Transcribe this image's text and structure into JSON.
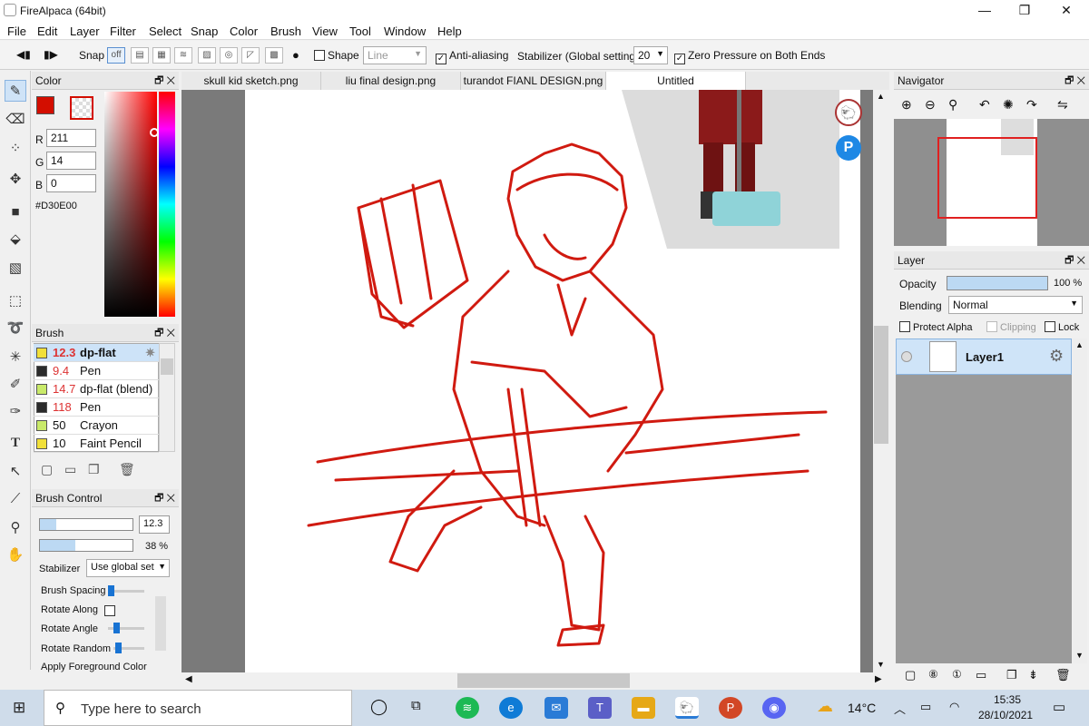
{
  "window": {
    "title": "FireAlpaca (64bit)"
  },
  "menu": [
    "File",
    "Edit",
    "Layer",
    "Filter",
    "Select",
    "Snap",
    "Color",
    "Brush",
    "View",
    "Tool",
    "Window",
    "Help"
  ],
  "toolbar": {
    "snap_label": "Snap",
    "snap_off": "off",
    "shape_label": "Shape",
    "shape_value": "Line",
    "antialias_label": "Anti-aliasing",
    "stabilizer_label": "Stabilizer (Global settings)",
    "stabilizer_value": "20",
    "zero_pressure_label": "Zero Pressure on Both Ends"
  },
  "color_panel": {
    "title": "Color",
    "r_label": "R",
    "r": "211",
    "g_label": "G",
    "g": "14",
    "b_label": "B",
    "b": "0",
    "hex": "#D30E00",
    "fg": "#d30e00"
  },
  "brush_panel": {
    "title": "Brush",
    "items": [
      {
        "size": "12.3",
        "name": "dp-flat",
        "swatch": "#f1e03a"
      },
      {
        "size": "9.4",
        "name": "Pen",
        "swatch": "#2b2b2b"
      },
      {
        "size": "14.7",
        "name": "dp-flat (blend)",
        "swatch": "#c9ea6a"
      },
      {
        "size": "118",
        "name": "Pen",
        "swatch": "#2b2b2b"
      },
      {
        "size": "50",
        "name": "Crayon",
        "swatch": "#c9ea6a"
      },
      {
        "size": "10",
        "name": "Faint Pencil",
        "swatch": "#f1e03a"
      }
    ]
  },
  "brush_control": {
    "title": "Brush Control",
    "size_value": "12.3",
    "size_fill": 0.18,
    "opacity_value": "38 %",
    "opacity_fill": 0.38,
    "stabilizer_label": "Stabilizer",
    "stabilizer_value": "Use global set",
    "spacing_label": "Brush Spacing",
    "rotate_along_label": "Rotate Along",
    "rotate_angle_label": "Rotate Angle",
    "rotate_random_label": "Rotate Random",
    "apply_fg_label": "Apply Foreground Color"
  },
  "tabs": [
    "skull kid sketch.png",
    "liu final design.png",
    "turandot FIANL DESIGN.png",
    "Untitled"
  ],
  "navigator": {
    "title": "Navigator"
  },
  "layer_panel": {
    "title": "Layer",
    "opacity_label": "Opacity",
    "opacity_value": "100 %",
    "opacity_fill": 1.0,
    "blending_label": "Blending",
    "blending_value": "Normal",
    "protect_alpha_label": "Protect Alpha",
    "clipping_label": "Clipping",
    "lock_label": "Lock",
    "layers": [
      {
        "name": "Layer1"
      }
    ]
  },
  "taskbar": {
    "search_placeholder": "Type here to search",
    "weather": "14°C",
    "time": "15:35",
    "date": "28/10/2021"
  }
}
